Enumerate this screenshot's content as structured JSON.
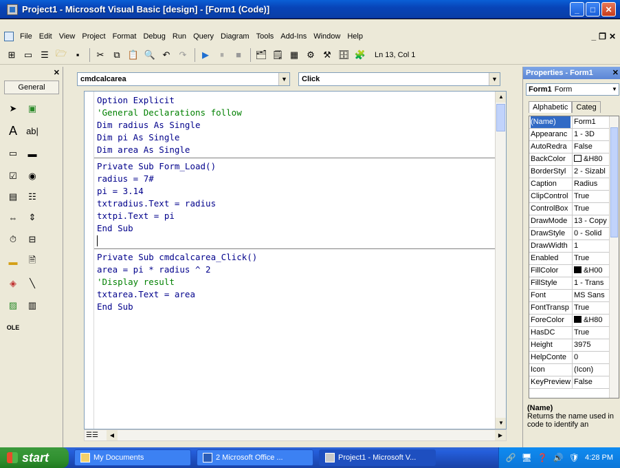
{
  "window": {
    "title": "Project1 - Microsoft Visual Basic [design] - [Form1 (Code)]"
  },
  "menu": [
    "File",
    "Edit",
    "View",
    "Project",
    "Format",
    "Debug",
    "Run",
    "Query",
    "Diagram",
    "Tools",
    "Add-Ins",
    "Window",
    "Help"
  ],
  "toolbar": {
    "position": "Ln 13, Col 1"
  },
  "toolbox": {
    "header": "General"
  },
  "code": {
    "object_combo": "cmdcalcarea",
    "proc_combo": "Click",
    "lines": [
      {
        "text": "Option Explicit",
        "style": "kw"
      },
      {
        "text": "'General Declarations follow",
        "style": "comment"
      },
      {
        "text": "Dim radius As Single",
        "style": "kw"
      },
      {
        "text": "Dim pi As Single",
        "style": "kw"
      },
      {
        "text": "Dim area As Single",
        "style": "kw"
      },
      {
        "text": "Private Sub Form_Load()",
        "style": "kw"
      },
      {
        "text": "radius = 7#",
        "style": "kw"
      },
      {
        "text": "pi = 3.14",
        "style": "kw"
      },
      {
        "text": "txtradius.Text = radius",
        "style": "kw"
      },
      {
        "text": "txtpi.Text = pi",
        "style": "kw"
      },
      {
        "text": "End Sub",
        "style": "kw"
      },
      {
        "text": "",
        "style": "kw"
      },
      {
        "text": "Private Sub cmdcalcarea_Click()",
        "style": "kw"
      },
      {
        "text": "area = pi * radius ^ 2",
        "style": "kw"
      },
      {
        "text": "'Display result",
        "style": "comment"
      },
      {
        "text": "txtarea.Text = area",
        "style": "kw"
      },
      {
        "text": "End Sub",
        "style": "kw"
      }
    ]
  },
  "properties": {
    "title": "Properties - Form1",
    "object": {
      "name": "Form1",
      "type": "Form"
    },
    "tabs": [
      "Alphabetic",
      "Categ"
    ],
    "rows": [
      {
        "name": "(Name)",
        "value": "Form1"
      },
      {
        "name": "Appearanc",
        "value": "1 - 3D"
      },
      {
        "name": "AutoRedra",
        "value": "False"
      },
      {
        "name": "BackColor",
        "value": "&H80",
        "swatch": "#ffffff"
      },
      {
        "name": "BorderStyl",
        "value": "2 - Sizabl"
      },
      {
        "name": "Caption",
        "value": "Radius"
      },
      {
        "name": "ClipControl",
        "value": "True"
      },
      {
        "name": "ControlBox",
        "value": "True"
      },
      {
        "name": "DrawMode",
        "value": "13 - Copy"
      },
      {
        "name": "DrawStyle",
        "value": "0 - Solid"
      },
      {
        "name": "DrawWidth",
        "value": "1"
      },
      {
        "name": "Enabled",
        "value": "True"
      },
      {
        "name": "FillColor",
        "value": "&H00",
        "swatch": "#000000"
      },
      {
        "name": "FillStyle",
        "value": "1 - Trans"
      },
      {
        "name": "Font",
        "value": "MS Sans"
      },
      {
        "name": "FontTransp",
        "value": "True"
      },
      {
        "name": "ForeColor",
        "value": "&H80",
        "swatch": "#000000"
      },
      {
        "name": "HasDC",
        "value": "True"
      },
      {
        "name": "Height",
        "value": "3975"
      },
      {
        "name": "HelpConte",
        "value": "0"
      },
      {
        "name": "Icon",
        "value": "(Icon)"
      },
      {
        "name": "KeyPreview",
        "value": "False"
      }
    ],
    "desc_title": "(Name)",
    "desc_text": "Returns the name used in code to identify an"
  },
  "taskbar": {
    "start": "start",
    "tasks": [
      "My Documents",
      "2 Microsoft Office ...",
      "Project1 - Microsoft V..."
    ],
    "clock": "4:28 PM"
  }
}
